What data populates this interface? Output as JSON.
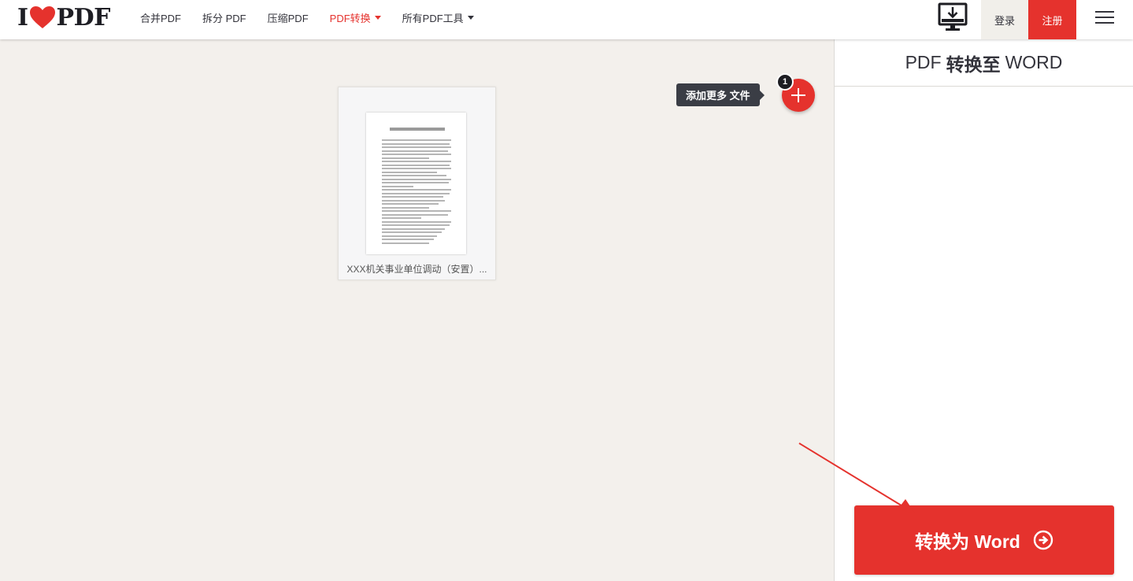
{
  "header": {
    "logo": {
      "text_left": "I",
      "text_right": "PDF",
      "heart_color": "#e5322d"
    },
    "nav": [
      {
        "label": "合并PDF"
      },
      {
        "label": "拆分 PDF"
      },
      {
        "label": "压缩PDF"
      },
      {
        "label": "PDF转换",
        "active": true,
        "has_dropdown": true
      },
      {
        "label": "所有PDF工具",
        "has_dropdown": true
      }
    ],
    "desktop_icon": "desktop-download-icon",
    "login_label": "登录",
    "signup_label": "注册",
    "menu_icon": "hamburger-menu-icon"
  },
  "workspace": {
    "file": {
      "name": "XXX机关事业单位调动（安置）..."
    },
    "add_more_tooltip": "添加更多 文件",
    "file_count": "1"
  },
  "sidebar": {
    "title_prefix": "PDF",
    "title_bold": "转换至",
    "title_suffix": "WORD",
    "convert_label": "转换为 Word"
  },
  "colors": {
    "accent": "#e5322d",
    "background": "#f3f0ec",
    "tooltip": "#3a3d45"
  }
}
